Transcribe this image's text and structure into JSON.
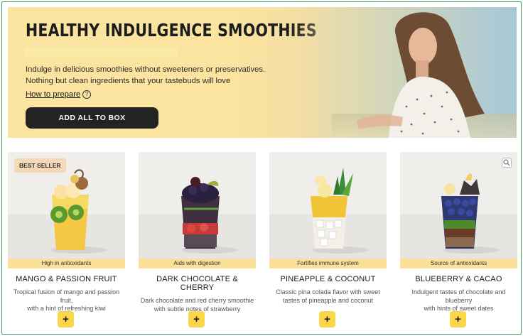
{
  "hero": {
    "title": "HEALTHY INDULGENCE SMOOTHIES",
    "description_line1": "Indulge in delicious smoothies without sweeteners or preservatives.",
    "description_line2": "Nothing but clean ingredients that your tastebuds will love",
    "how_to_link": "How to prepare",
    "help_icon": "?",
    "add_all_label": "ADD ALL TO BOX"
  },
  "colors": {
    "hero_bg": "#fbe3a0",
    "button_dark": "#232323",
    "tag_yellow": "#fbe09a",
    "plus_yellow": "#f9d64a",
    "best_seller_bg": "#f5d9b7",
    "frame_green": "#3f9e5c"
  },
  "products": [
    {
      "badge": "BEST SELLER",
      "tag": "High in antioxidants",
      "name": "MANGO & PASSION FRUIT",
      "desc_line1": "Tropical fusion of mango and passion fruit,",
      "desc_line2": "with a hint of refreshing kiwi",
      "add_label": "+"
    },
    {
      "tag": "Aids with digestion",
      "name": "DARK CHOCOLATE & CHERRY",
      "desc_line1": "Dark chocolate and red cherry smoothie",
      "desc_line2": "with subtle notes of strawberry",
      "add_label": "+"
    },
    {
      "tag": "Fortifies immune system",
      "name": "PINEAPPLE & COCONUT",
      "desc_line1": "Classic pina colada flavor with sweet",
      "desc_line2": "tastes of pineapple and coconut",
      "add_label": "+"
    },
    {
      "tag": "Source of antioxidants",
      "name": "BLUEBERRY & CACAO",
      "desc_line1": "Indulgent tastes of chocolate and blueberry",
      "desc_line2": "with hints of sweet dates",
      "add_label": "+",
      "icon": "expand-icon"
    }
  ]
}
